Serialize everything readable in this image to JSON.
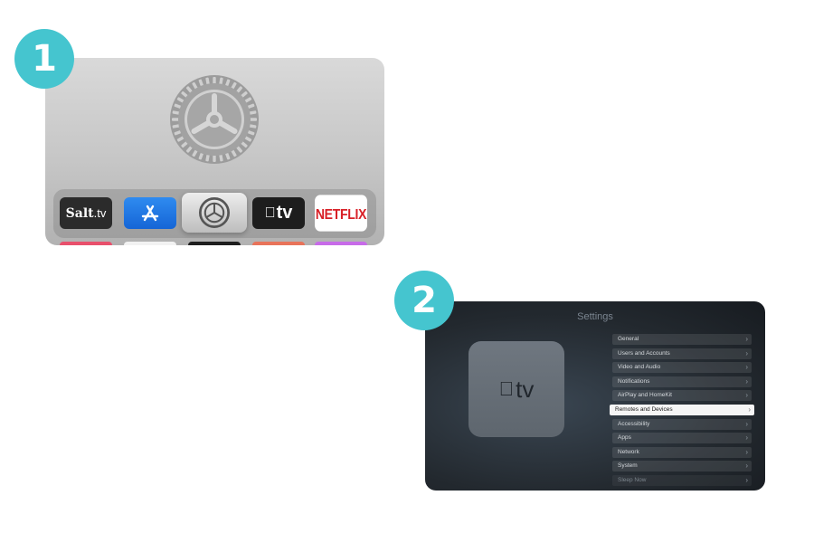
{
  "steps": {
    "one": "1",
    "two": "2"
  },
  "home": {
    "apps": [
      {
        "name": "Salt.tv",
        "brand": "Salt",
        "suffix": ".tv"
      },
      {
        "name": "App Store",
        "icon": "app-store-icon"
      },
      {
        "name": "Settings",
        "icon": "gear-icon",
        "focused": true
      },
      {
        "name": "Apple TV",
        "label": "tv",
        "icon": "apple-logo-icon"
      },
      {
        "name": "Netflix",
        "label": "NETFLIX"
      }
    ],
    "row2_colors": [
      "#e8506c",
      "#f2f2f2",
      "#1f1f1f",
      "#e8735a",
      "#c76be8"
    ]
  },
  "settings": {
    "title": "Settings",
    "device_label": "tv",
    "menu": [
      {
        "label": "General"
      },
      {
        "label": "Users and Accounts"
      },
      {
        "label": "Video and Audio"
      },
      {
        "label": "Notifications"
      },
      {
        "label": "AirPlay and HomeKit"
      },
      {
        "label": "Remotes and Devices",
        "selected": true
      },
      {
        "label": "Accessibility"
      },
      {
        "label": "Apps"
      },
      {
        "label": "Network"
      },
      {
        "label": "System"
      },
      {
        "label": "Sleep Now"
      }
    ]
  },
  "colors": {
    "badge": "#45c5cf",
    "netflix": "#d81f26",
    "app_store": "#1f77e6"
  }
}
